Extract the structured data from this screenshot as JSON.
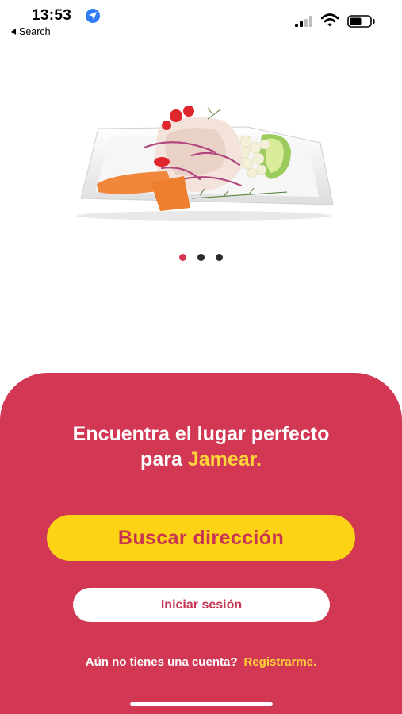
{
  "status_bar": {
    "time": "13:53",
    "back_label": "Search",
    "icons": [
      "location-arrow-icon",
      "cellular-signal-icon",
      "wifi-icon",
      "battery-icon"
    ]
  },
  "carousel": {
    "image": "ceviche-plate",
    "pages": 3,
    "active_index": 0,
    "active_color": "#d63450",
    "inactive_color": "#2c2c2c"
  },
  "panel": {
    "background": "#d23754",
    "headline_line1": "Encuentra el lugar perfecto",
    "headline_line2_prefix": "para ",
    "headline_accent": "Jamear.",
    "accent_color": "#ffd43b"
  },
  "buttons": {
    "search_label": "Buscar dirección",
    "login_label": "Iniciar sesión"
  },
  "register": {
    "prompt": "Aún no tienes una cuenta?",
    "link_label": "Registrarme."
  }
}
